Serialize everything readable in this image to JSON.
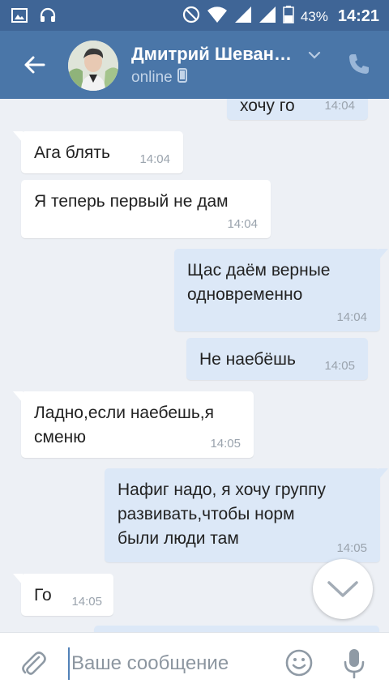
{
  "statusbar": {
    "battery": "43%",
    "time": "14:21",
    "icons": [
      "gallery-icon",
      "headset-icon",
      "dnd-icon",
      "wifi-icon",
      "signal-icon",
      "signal-icon-2",
      "battery-icon"
    ]
  },
  "header": {
    "name": "Дмитрий Шеван…",
    "status": "online",
    "icons": [
      "back-arrow-icon",
      "chevron-down-icon",
      "phone-icon",
      "mobile-device-icon"
    ]
  },
  "messages": [
    {
      "dir": "out",
      "text": "хочу го",
      "time": "14:04"
    },
    {
      "dir": "in",
      "text": "Ага блять",
      "time": "14:04"
    },
    {
      "dir": "in",
      "text": "Я теперь первый не дам",
      "time": "14:04"
    },
    {
      "dir": "out",
      "text": "Щас даём верные\nодновременно",
      "time": "14:04"
    },
    {
      "dir": "out",
      "text": "Не наебёшь",
      "time": "14:05"
    },
    {
      "dir": "in",
      "text": "Ладно,если наебешь,я\nсменю",
      "time": "14:05"
    },
    {
      "dir": "out",
      "text": "Нафиг надо, я хочу группу\nразвивать,чтобы норм\nбыли люди там",
      "time": "14:05"
    },
    {
      "dir": "in",
      "text": "Го",
      "time": "14:05"
    }
  ],
  "composer": {
    "placeholder": "Ваше сообщение",
    "icons": [
      "paperclip-icon",
      "emoji-icon",
      "microphone-icon",
      "scroll-down-icon"
    ]
  },
  "colors": {
    "statusbar": "#3f6596",
    "header": "#4a76a8",
    "chat_bg": "#edf0f5",
    "incoming": "#ffffff",
    "outgoing": "#dce8f7"
  }
}
